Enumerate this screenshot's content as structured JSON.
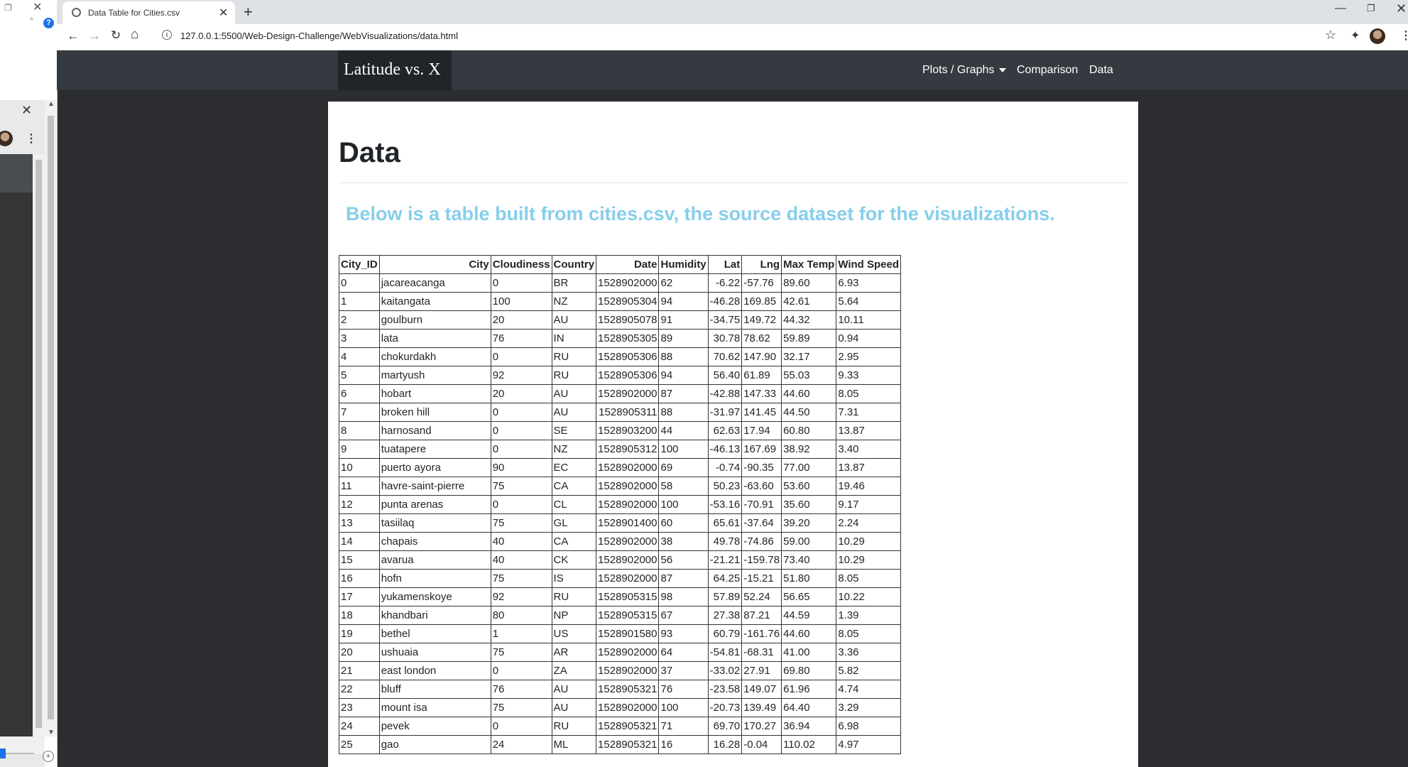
{
  "browser": {
    "tab_title": "Data Table for Cities.csv",
    "url": "127.0.0.1:5500/Web-Design-Challenge/WebVisualizations/data.html"
  },
  "navbar": {
    "brand": "Latitude vs. X",
    "items": [
      "Plots / Graphs",
      "Comparison",
      "Data"
    ]
  },
  "page": {
    "title": "Data",
    "subtitle": "Below is a table built from cities.csv, the source dataset for the visualizations."
  },
  "table": {
    "headers": [
      "City_ID",
      "City",
      "Cloudiness",
      "Country",
      "Date",
      "Humidity",
      "Lat",
      "Lng",
      "Max Temp",
      "Wind Speed"
    ],
    "rows": [
      [
        "0",
        "jacareacanga",
        "0",
        "BR",
        "1528902000",
        "62",
        "-6.22",
        "-57.76",
        "89.60",
        "6.93"
      ],
      [
        "1",
        "kaitangata",
        "100",
        "NZ",
        "1528905304",
        "94",
        "-46.28",
        "169.85",
        "42.61",
        "5.64"
      ],
      [
        "2",
        "goulburn",
        "20",
        "AU",
        "1528905078",
        "91",
        "-34.75",
        "149.72",
        "44.32",
        "10.11"
      ],
      [
        "3",
        "lata",
        "76",
        "IN",
        "1528905305",
        "89",
        "30.78",
        "78.62",
        "59.89",
        "0.94"
      ],
      [
        "4",
        "chokurdakh",
        "0",
        "RU",
        "1528905306",
        "88",
        "70.62",
        "147.90",
        "32.17",
        "2.95"
      ],
      [
        "5",
        "martyush",
        "92",
        "RU",
        "1528905306",
        "94",
        "56.40",
        "61.89",
        "55.03",
        "9.33"
      ],
      [
        "6",
        "hobart",
        "20",
        "AU",
        "1528902000",
        "87",
        "-42.88",
        "147.33",
        "44.60",
        "8.05"
      ],
      [
        "7",
        "broken hill",
        "0",
        "AU",
        "1528905311",
        "88",
        "-31.97",
        "141.45",
        "44.50",
        "7.31"
      ],
      [
        "8",
        "harnosand",
        "0",
        "SE",
        "1528903200",
        "44",
        "62.63",
        "17.94",
        "60.80",
        "13.87"
      ],
      [
        "9",
        "tuatapere",
        "0",
        "NZ",
        "1528905312",
        "100",
        "-46.13",
        "167.69",
        "38.92",
        "3.40"
      ],
      [
        "10",
        "puerto ayora",
        "90",
        "EC",
        "1528902000",
        "69",
        "-0.74",
        "-90.35",
        "77.00",
        "13.87"
      ],
      [
        "11",
        "havre-saint-pierre",
        "75",
        "CA",
        "1528902000",
        "58",
        "50.23",
        "-63.60",
        "53.60",
        "19.46"
      ],
      [
        "12",
        "punta arenas",
        "0",
        "CL",
        "1528902000",
        "100",
        "-53.16",
        "-70.91",
        "35.60",
        "9.17"
      ],
      [
        "13",
        "tasiilaq",
        "75",
        "GL",
        "1528901400",
        "60",
        "65.61",
        "-37.64",
        "39.20",
        "2.24"
      ],
      [
        "14",
        "chapais",
        "40",
        "CA",
        "1528902000",
        "38",
        "49.78",
        "-74.86",
        "59.00",
        "10.29"
      ],
      [
        "15",
        "avarua",
        "40",
        "CK",
        "1528902000",
        "56",
        "-21.21",
        "-159.78",
        "73.40",
        "10.29"
      ],
      [
        "16",
        "hofn",
        "75",
        "IS",
        "1528902000",
        "87",
        "64.25",
        "-15.21",
        "51.80",
        "8.05"
      ],
      [
        "17",
        "yukamenskoye",
        "92",
        "RU",
        "1528905315",
        "98",
        "57.89",
        "52.24",
        "56.65",
        "10.22"
      ],
      [
        "18",
        "khandbari",
        "80",
        "NP",
        "1528905315",
        "67",
        "27.38",
        "87.21",
        "44.59",
        "1.39"
      ],
      [
        "19",
        "bethel",
        "1",
        "US",
        "1528901580",
        "93",
        "60.79",
        "-161.76",
        "44.60",
        "8.05"
      ],
      [
        "20",
        "ushuaia",
        "75",
        "AR",
        "1528902000",
        "64",
        "-54.81",
        "-68.31",
        "41.00",
        "3.36"
      ],
      [
        "21",
        "east london",
        "0",
        "ZA",
        "1528902000",
        "37",
        "-33.02",
        "27.91",
        "69.80",
        "5.82"
      ],
      [
        "22",
        "bluff",
        "76",
        "AU",
        "1528905321",
        "76",
        "-23.58",
        "149.07",
        "61.96",
        "4.74"
      ],
      [
        "23",
        "mount isa",
        "75",
        "AU",
        "1528902000",
        "100",
        "-20.73",
        "139.49",
        "64.40",
        "3.29"
      ],
      [
        "24",
        "pevek",
        "0",
        "RU",
        "1528905321",
        "71",
        "69.70",
        "170.27",
        "36.94",
        "6.98"
      ],
      [
        "25",
        "gao",
        "24",
        "ML",
        "1528905321",
        "16",
        "16.28",
        "-0.04",
        "110.02",
        "4.97"
      ]
    ]
  }
}
